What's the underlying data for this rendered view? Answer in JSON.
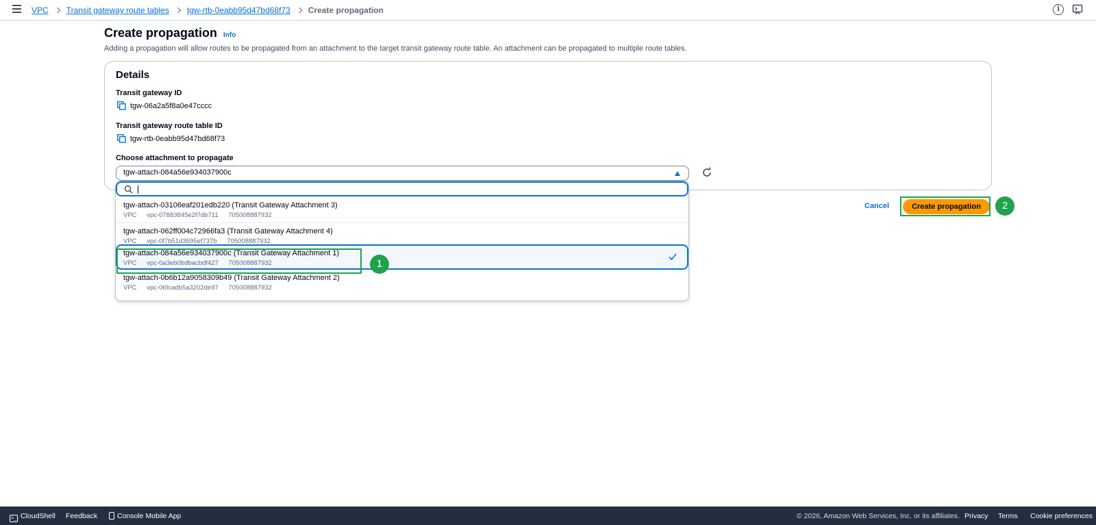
{
  "breadcrumb": {
    "items": [
      "VPC",
      "Transit gateway route tables",
      "tgw-rtb-0eabb95d47bd68f73"
    ],
    "current": "Create propagation"
  },
  "header": {
    "info_icon_char": "i"
  },
  "page": {
    "title": "Create propagation",
    "info_link": "Info",
    "description": "Adding a propagation will allow routes to be propagated from an attachment to the target transit gateway route table. An attachment can be propagated to multiple route tables."
  },
  "details": {
    "title": "Details",
    "tgw_id_label": "Transit gateway ID",
    "tgw_id_value": "tgw-06a2a5f8a0e47cccc",
    "rtb_id_label": "Transit gateway route table ID",
    "rtb_id_value": "tgw-rtb-0eabb95d47bd68f73",
    "attachment_label": "Choose attachment to propagate",
    "attachment_selected": "tgw-attach-084a56e934037900c"
  },
  "dropdown": {
    "filter_value": "",
    "options": [
      {
        "label": "tgw-attach-03106eaf201edb220 (Transit Gateway Attachment 3)",
        "type": "VPC",
        "vpc": "vpc-07883845e2f7db711",
        "account": "705008887932",
        "selected": false
      },
      {
        "label": "tgw-attach-062ff004c72966fa3 (Transit Gateway Attachment 4)",
        "type": "VPC",
        "vpc": "vpc-0f7b51d3695ef737b",
        "account": "705008887932",
        "selected": false
      },
      {
        "label": "tgw-attach-084a56e934037900c (Transit Gateway Attachment 1)",
        "type": "VPC",
        "vpc": "vpc-0a3eb0bdbacbdf427",
        "account": "705008887932",
        "selected": true
      },
      {
        "label": "tgw-attach-0b6b12a9058309b49 (Transit Gateway Attachment 2)",
        "type": "VPC",
        "vpc": "vpc-06fcadb5a3202de97",
        "account": "705008887932",
        "selected": false
      }
    ]
  },
  "actions": {
    "cancel": "Cancel",
    "create": "Create propagation"
  },
  "annotations": {
    "badge1": "1",
    "badge2": "2"
  },
  "footer": {
    "cloudshell": "CloudShell",
    "feedback": "Feedback",
    "mobile_app": "Console Mobile App",
    "copyright": "© 2026, Amazon Web Services, Inc. or its affiliates.",
    "privacy": "Privacy",
    "terms": "Terms",
    "cookies": "Cookie preferences"
  },
  "colors": {
    "link": "#0972d3",
    "primary_button": "#ff9900",
    "annotation": "#1fa24b",
    "footer_bg": "#232f3e"
  }
}
